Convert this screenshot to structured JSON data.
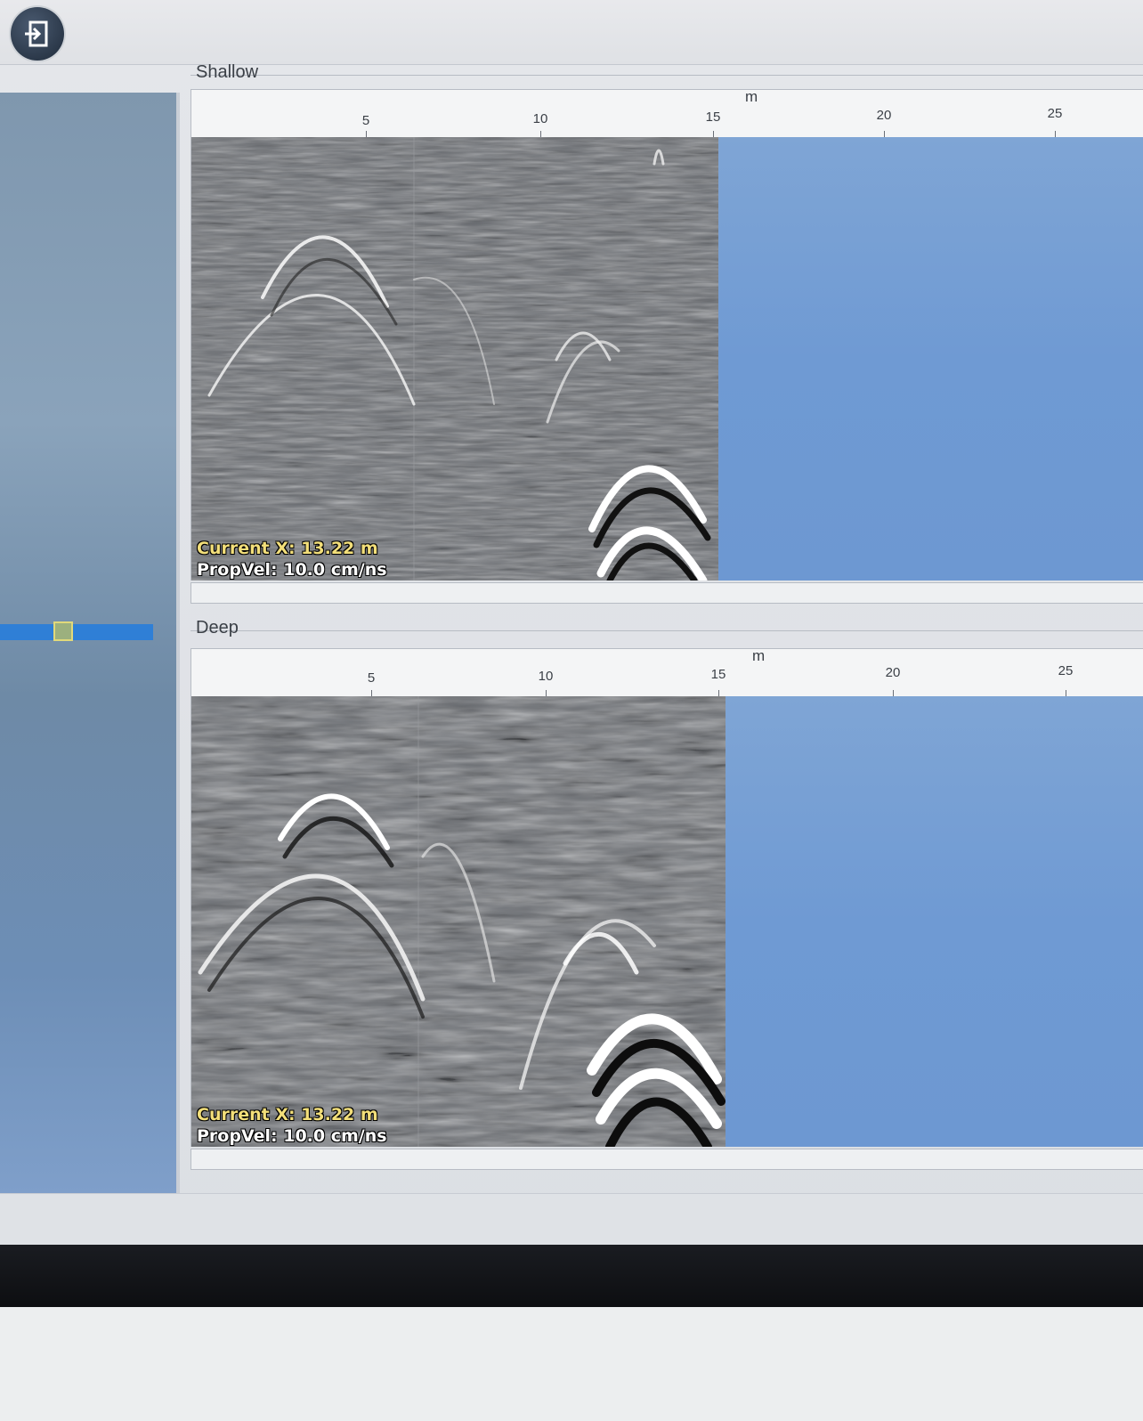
{
  "toolbar": {
    "exit_icon": "exit-door-icon"
  },
  "shallow": {
    "label": "Shallow",
    "axis_unit": "m",
    "ticks": [
      "5",
      "10",
      "15",
      "20",
      "25"
    ],
    "readout": {
      "current": "Current X: 13.22 m",
      "velocity": "PropVel: 10.0 cm/ns"
    }
  },
  "deep": {
    "label": "Deep",
    "axis_unit": "m",
    "ticks": [
      "5",
      "10",
      "15",
      "20",
      "25"
    ],
    "readout": {
      "current": "Current X: 13.22 m",
      "velocity": "PropVel: 10.0 cm/ns"
    }
  },
  "colors": {
    "readout_current": "#f3df7a",
    "readout_velocity": "#ffffff",
    "plot_background": "#6f9ad3",
    "scroll_accent": "#2f7fd6"
  }
}
